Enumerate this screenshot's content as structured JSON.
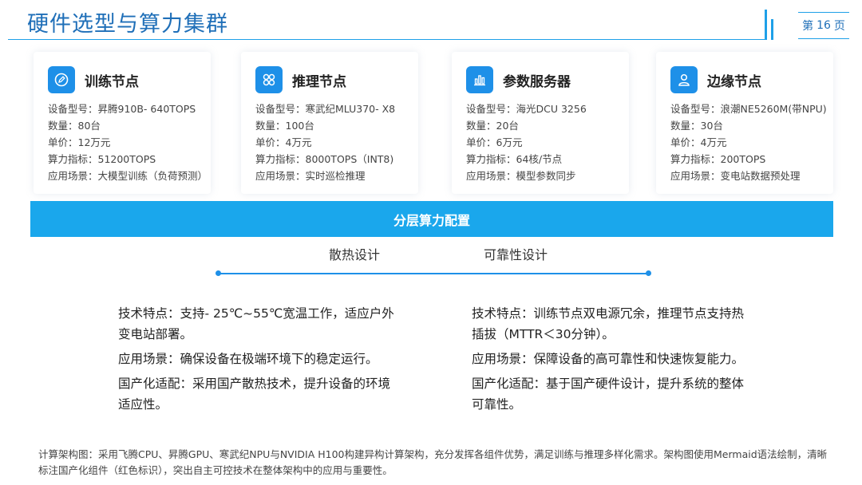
{
  "header": {
    "title": "硬件选型与算力集群",
    "page_prefix": "第",
    "page_number": "16",
    "page_suffix": "页"
  },
  "cards": [
    {
      "icon": "edit-icon",
      "title": "训练节点",
      "lines": [
        "设备型号：昇腾910B- 640TOPS",
        "数量：80台",
        "单价：12万元",
        "算力指标：51200TOPS",
        "应用场景：大模型训练（负荷预测）"
      ]
    },
    {
      "icon": "grid-icon",
      "title": "推理节点",
      "lines": [
        "设备型号：寒武纪MLU370- X8",
        "数量：100台",
        "单价：4万元",
        "算力指标：8000TOPS（INT8)",
        "应用场景：实时巡检推理"
      ]
    },
    {
      "icon": "bar-chart-icon",
      "title": "参数服务器",
      "lines": [
        "设备型号：海光DCU 3256",
        "数量：20台",
        "单价：6万元",
        "算力指标：64核/节点",
        "应用场景：模型参数同步"
      ]
    },
    {
      "icon": "user-icon",
      "title": "边缘节点",
      "lines": [
        "设备型号：浪潮NE5260M(带NPU)",
        "数量：30台",
        "单价：4万元",
        "算力指标：200TOPS",
        "应用场景：变电站数据预处理"
      ]
    }
  ],
  "band": {
    "label": "分层算力配置"
  },
  "design": {
    "left_label": "散热设计",
    "right_label": "可靠性设计",
    "left_paragraphs": [
      "技术特点：支持- 25℃~55℃宽温工作，适应户外变电站部署。",
      "应用场景：确保设备在极端环境下的稳定运行。",
      "国产化适配：采用国产散热技术，提升设备的环境适应性。"
    ],
    "right_paragraphs": [
      "技术特点：训练节点双电源冗余，推理节点支持热插拔（MTTR＜30分钟）。",
      "应用场景：保障设备的高可靠性和快速恢复能力。",
      "国产化适配：基于国产硬件设计，提升系统的整体可靠性。"
    ]
  },
  "footnote": "计算架构图：采用飞腾CPU、昇腾GPU、寒武纪NPU与NVIDIA H100构建异构计算架构，充分发挥各组件优势，满足训练与推理多样化需求。架构图使用Mermaid语法绘制，清晰标注国产化组件（红色标识），突出自主可控技术在整体架构中的应用与重要性。",
  "colors": {
    "accent": "#1aa7ec",
    "title": "#1f6fb8"
  }
}
